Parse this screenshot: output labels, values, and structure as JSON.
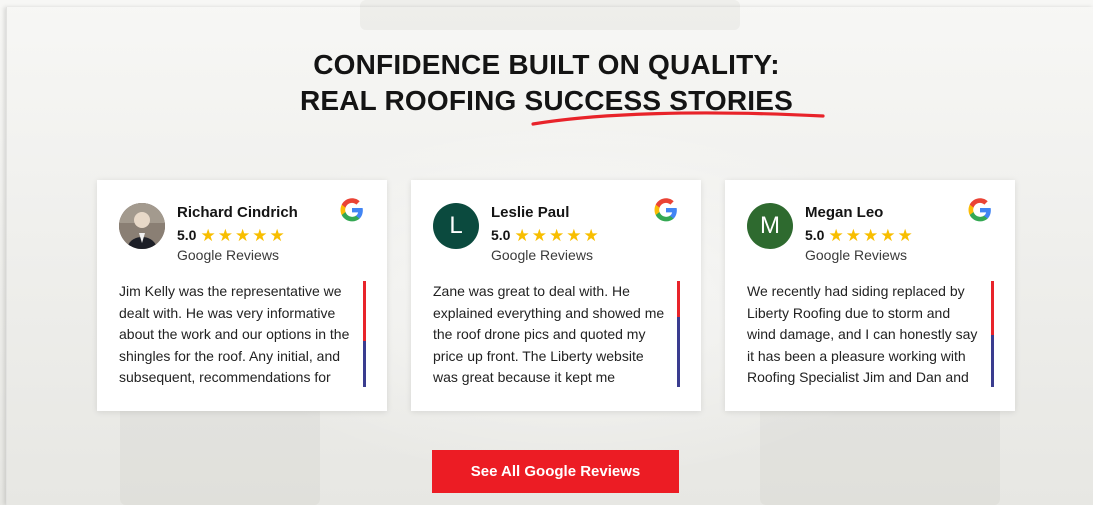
{
  "section": {
    "title_line1": "CONFIDENCE BUILT ON QUALITY:",
    "title_line2": "REAL ROOFING SUCCESS STORIES"
  },
  "colors": {
    "accent_red": "#ec1c24",
    "scrollbar_blue": "#3a3c8f",
    "star_yellow": "#f8be00"
  },
  "reviews": [
    {
      "name": "Richard Cindrich",
      "rating": "5.0",
      "stars": 5,
      "source": "Google Reviews",
      "avatar_type": "photo",
      "text": "Jim Kelly was the representative we dealt with. He was very informative about the work and our options in the shingles for the roof. Any initial, and subsequent, recommendations for"
    },
    {
      "name": "Leslie Paul",
      "rating": "5.0",
      "stars": 5,
      "source": "Google Reviews",
      "avatar_letter": "L",
      "avatar_color": "#0b4a3e",
      "text": "Zane was great to deal with. He explained everything and showed me the roof drone pics and quoted my price up front. The Liberty website was great because it kept me informed of"
    },
    {
      "name": "Megan Leo",
      "rating": "5.0",
      "stars": 5,
      "source": "Google Reviews",
      "avatar_letter": "M",
      "avatar_color": "#2e6a2f",
      "text": "We recently had siding replaced by Liberty Roofing due to storm and wind damage, and I can honestly say it has been a pleasure working with Roofing Specialist Jim and Dan and his crew."
    }
  ],
  "cta": {
    "label": "See All Google Reviews"
  },
  "icons": {
    "google": "google-logo-icon",
    "star": "star-icon",
    "underline": "swoosh-underline-icon"
  }
}
